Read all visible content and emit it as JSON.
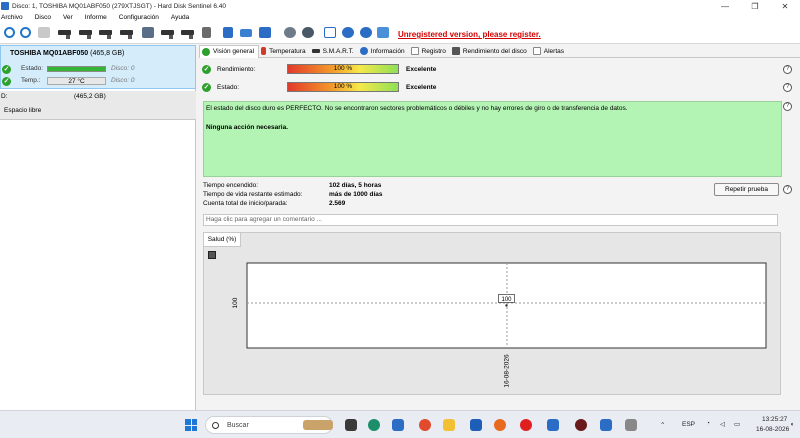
{
  "window": {
    "title": "Disco: 1, TOSHIBA MQ01ABF050 (279XTJSGT)  -  Hard Disk Sentinel 6.40",
    "minimize": "—",
    "maximize": "❐",
    "close": "✕"
  },
  "menu": [
    "Archivo",
    "Disco",
    "Ver",
    "Informe",
    "Configuración",
    "Ayuda"
  ],
  "unregistered_text": "Unregistered version, please register.",
  "disk": {
    "name": "TOSHIBA MQ01ABF050",
    "size": "(465,8 GB)",
    "estado_label": "Estado:",
    "disco_label": "Disco: 0",
    "temp_label": "Temp.:",
    "temp_value": "27 °C",
    "disco2_label": "Disco: 0",
    "health_fraction": 1.0
  },
  "partition": {
    "letter": "D:",
    "size": "(465,2 GB)",
    "free_label": "Espacio libre"
  },
  "tabs": [
    {
      "label": "Visión general",
      "icon": "check-icon",
      "color": "#2ca02c"
    },
    {
      "label": "Temperatura",
      "icon": "thermometer-icon",
      "color": "#d03a2a"
    },
    {
      "label": "S.M.A.R.T.",
      "icon": "smart-icon",
      "color": "#333333"
    },
    {
      "label": "Información",
      "icon": "info-icon",
      "color": "#2b6cc4"
    },
    {
      "label": "Registro",
      "icon": "log-icon",
      "color": "#888888"
    },
    {
      "label": "Rendimiento del disco",
      "icon": "performance-icon",
      "color": "#555555"
    },
    {
      "label": "Alertas",
      "icon": "alerts-icon",
      "color": "#888888"
    }
  ],
  "overview": {
    "rendimiento_label": "Rendimiento:",
    "rendimiento_value": "100 %",
    "rendimiento_text": "Excelente",
    "rendimiento_fraction": 1.0,
    "estado_label": "Estado:",
    "estado_value": "100 %",
    "estado_text": "Excelente",
    "estado_fraction": 1.0,
    "message_line1": "El estado del disco duro es PERFECTO. No se encontraron sectores problemáticos o débiles y no hay errores de giro o de transferencia de datos.",
    "message_line2": "Ninguna acción necesaria.",
    "stats": [
      {
        "label": "Tiempo encendido:",
        "value": "102 días, 5 horas"
      },
      {
        "label": "Tiempo de vida restante estimado:",
        "value": "más de 1000 días"
      },
      {
        "label": "Cuenta total de inicio/parada:",
        "value": "2.569"
      }
    ],
    "repeat_button": "Repetir prueba",
    "comment_placeholder": "Haga clic para agregar un comentario ..."
  },
  "chart_data": {
    "type": "line",
    "title": "",
    "tab_label": "Salud (%)",
    "xlabel": "",
    "ylabel": "",
    "x": [
      "16-08-2026"
    ],
    "series": [
      {
        "values": [
          100
        ]
      }
    ],
    "data_labels": [
      "100"
    ],
    "y_tick_label": "100",
    "grid": true
  },
  "taskbar": {
    "search_placeholder": "Buscar",
    "lang": "ESP",
    "time": "13:25:27",
    "date": "16-08-2026"
  }
}
